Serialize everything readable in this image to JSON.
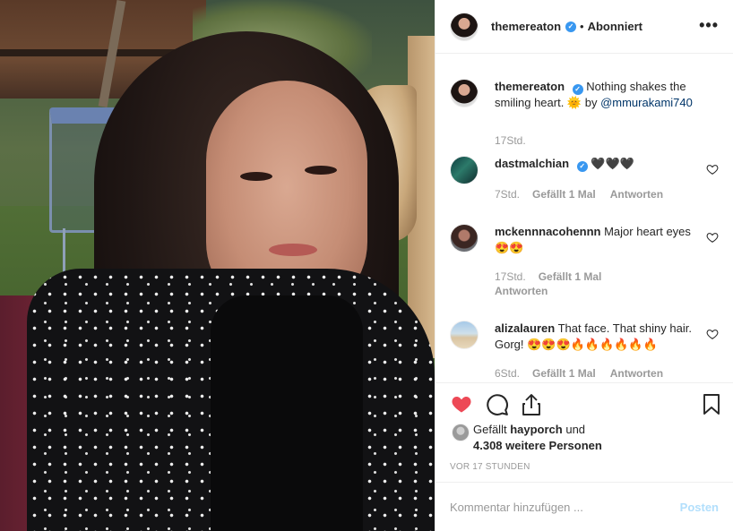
{
  "post": {
    "image_alt": "",
    "author": "themereaton",
    "follow_status": "Abonniert",
    "separator": "•",
    "more_label": "•••"
  },
  "caption": {
    "user": "themereaton",
    "text": "Nothing shakes the smiling heart. 🌞 by",
    "mention": "@mmurakami740",
    "time": "17Std."
  },
  "comments": [
    {
      "user": "dastmalchian",
      "verified": true,
      "text": "🖤🖤🖤",
      "time": "7Std.",
      "likes": "Gefällt 1 Mal",
      "reply": "Antworten"
    },
    {
      "user": "mckennnacohennn",
      "verified": false,
      "text": "Major heart eyes 😍😍",
      "time": "17Std.",
      "likes": "Gefällt 1 Mal",
      "reply": "Antworten"
    },
    {
      "user": "alizalauren",
      "verified": false,
      "text": "That face. That shiny hair. Gorg! 😍😍😍🔥🔥🔥🔥🔥🔥",
      "time": "6Std.",
      "likes": "Gefällt 1 Mal",
      "reply": "Antworten"
    }
  ],
  "likes": {
    "prefix": "Gefällt",
    "user": "hayporch",
    "suffix": "und",
    "others": "4.308 weitere Personen"
  },
  "timestamp": "VOR 17 STUNDEN",
  "comment_box": {
    "placeholder": "Kommentar hinzufügen ...",
    "post_label": "Posten"
  },
  "icons": {
    "like": "heart-filled-icon",
    "comment": "comment-bubble-icon",
    "share": "share-icon",
    "save": "bookmark-icon",
    "verified": "verified-badge-icon"
  },
  "colors": {
    "like_red": "#ed4956",
    "verified_blue": "#3897f0",
    "link": "#003569",
    "post_button": "#b2dffc",
    "muted": "#999999"
  }
}
